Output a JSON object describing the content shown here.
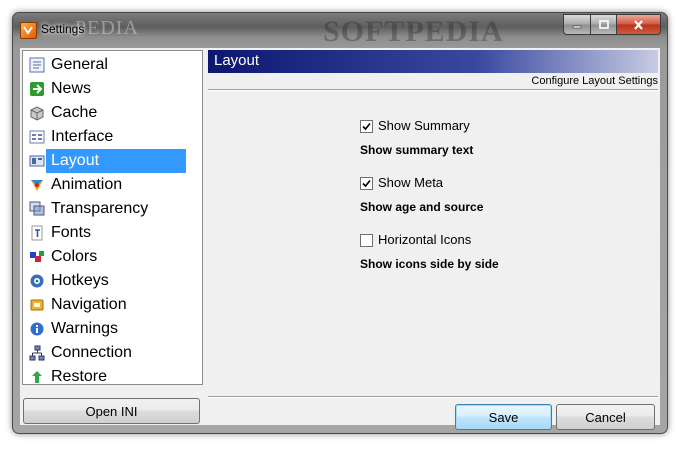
{
  "window": {
    "title": "Settings",
    "watermark": "SOFTPEDIA",
    "watermark_small": "PEDIA"
  },
  "sidebar": {
    "items": [
      {
        "label": "General",
        "icon": "general-icon"
      },
      {
        "label": "News",
        "icon": "news-arrow-icon"
      },
      {
        "label": "Cache",
        "icon": "cache-box-icon"
      },
      {
        "label": "Interface",
        "icon": "interface-window-icon"
      },
      {
        "label": "Layout",
        "icon": "layout-icon",
        "selected": true
      },
      {
        "label": "Animation",
        "icon": "animation-icon"
      },
      {
        "label": "Transparency",
        "icon": "transparency-icon"
      },
      {
        "label": "Fonts",
        "icon": "fonts-icon"
      },
      {
        "label": "Colors",
        "icon": "colors-icon"
      },
      {
        "label": "Hotkeys",
        "icon": "hotkeys-icon"
      },
      {
        "label": "Navigation",
        "icon": "navigation-icon"
      },
      {
        "label": "Warnings",
        "icon": "warnings-info-icon"
      },
      {
        "label": "Connection",
        "icon": "connection-network-icon"
      },
      {
        "label": "Restore",
        "icon": "restore-arrow-icon"
      }
    ],
    "open_ini_label": "Open INI"
  },
  "panel": {
    "title": "Layout",
    "subtitle": "Configure Layout Settings",
    "options": [
      {
        "label": "Show Summary",
        "checked": true,
        "description": "Show summary text"
      },
      {
        "label": "Show Meta",
        "checked": true,
        "description": "Show age and source"
      },
      {
        "label": "Horizontal Icons",
        "checked": false,
        "description": "Show icons side by side"
      }
    ]
  },
  "footer": {
    "save_label": "Save",
    "cancel_label": "Cancel"
  },
  "colors": {
    "selection": "#3399ff",
    "header_start": "#0c1770",
    "header_end": "#c7cbe3"
  }
}
